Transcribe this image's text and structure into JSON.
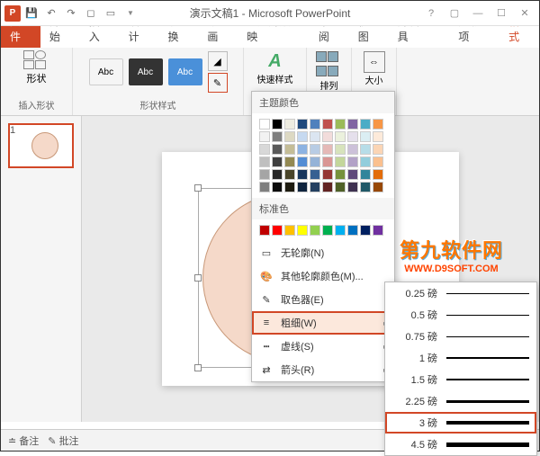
{
  "title": "演示文稿1 - Microsoft PowerPoint",
  "tabs": {
    "file": "文件",
    "home": "开始",
    "insert": "插入",
    "design": "设计",
    "transitions": "切换",
    "animations": "动画",
    "slideshow": "幻灯片放映",
    "review": "审阅",
    "view": "视图",
    "developer": "开发工具",
    "addins": "加载项",
    "format": "格式"
  },
  "ribbon": {
    "insert_shapes": "插入形状",
    "shapes_label": "形状",
    "shape_styles": "形状样式",
    "abc": "Abc",
    "quick_styles": "快速样式",
    "arrange": "排列",
    "size": "大小"
  },
  "thumb": {
    "num": "1"
  },
  "dropdown": {
    "theme_colors": "主题颜色",
    "standard_colors": "标准色",
    "no_outline": "无轮廓(N)",
    "more_colors": "其他轮廓颜色(M)...",
    "eyedropper": "取色器(E)",
    "weight": "粗细(W)",
    "dashes": "虚线(S)",
    "arrows": "箭头(R)"
  },
  "weights": {
    "w025": "0.25 磅",
    "w05": "0.5 磅",
    "w075": "0.75 磅",
    "w1": "1 磅",
    "w15": "1.5 磅",
    "w225": "2.25 磅",
    "w3": "3 磅",
    "w45": "4.5 磅"
  },
  "statusbar": {
    "notes": "备注",
    "comments": "批注"
  },
  "watermark": {
    "line1": "第九软件网",
    "line2": "WWW.D9SOFT.COM"
  },
  "theme_palette": [
    "#ffffff",
    "#000000",
    "#eeece1",
    "#1f497d",
    "#4f81bd",
    "#c0504d",
    "#9bbb59",
    "#8064a2",
    "#4bacc6",
    "#f79646",
    "#f2f2f2",
    "#7f7f7f",
    "#ddd9c3",
    "#c6d9f0",
    "#dbe5f1",
    "#f2dcdb",
    "#ebf1dd",
    "#e5e0ec",
    "#dbeef3",
    "#fdeada",
    "#d8d8d8",
    "#595959",
    "#c4bd97",
    "#8db3e2",
    "#b8cce4",
    "#e5b9b7",
    "#d7e3bc",
    "#ccc1d9",
    "#b7dde8",
    "#fbd5b5",
    "#bfbfbf",
    "#3f3f3f",
    "#938953",
    "#548dd4",
    "#95b3d7",
    "#d99694",
    "#c3d69b",
    "#b2a2c7",
    "#92cddc",
    "#fac08f",
    "#a5a5a5",
    "#262626",
    "#494429",
    "#17365d",
    "#366092",
    "#953734",
    "#76923c",
    "#5f497a",
    "#31859b",
    "#e36c09",
    "#7f7f7f",
    "#0c0c0c",
    "#1d1b10",
    "#0f243e",
    "#244061",
    "#632423",
    "#4f6128",
    "#3f3151",
    "#205867",
    "#974806"
  ],
  "standard_palette": [
    "#c00000",
    "#ff0000",
    "#ffc000",
    "#ffff00",
    "#92d050",
    "#00b050",
    "#00b0f0",
    "#0070c0",
    "#002060",
    "#7030a0"
  ]
}
